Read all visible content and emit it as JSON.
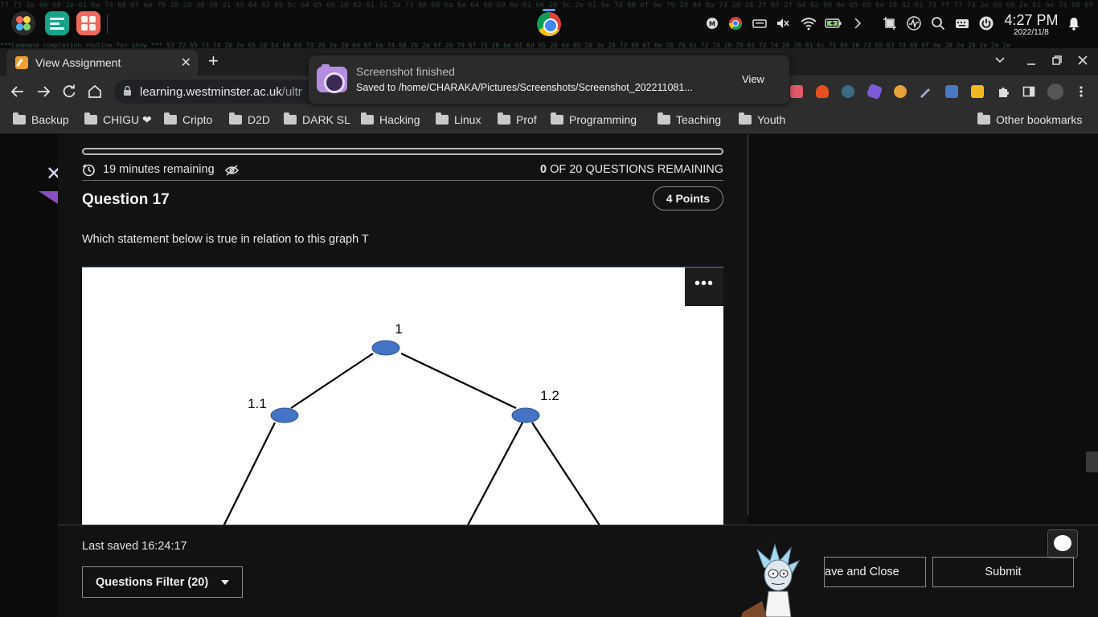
{
  "os_panel": {
    "clock_time": "4:27 PM",
    "clock_date": "2022/11/8",
    "hex_line_top": "77 73 2e 66 68 2e 61 6e 74 68 6f 6e 79 20 29 30 38 31 43 64 63 69 6c 64 65 66 20 42 61 31 3a 73 68 68 6a 6e 64 68 69 6e 61 66 20 3c 2e 61 6e 74 68 6f 6e 79 20 84 8a 73 28 28 2f 6f 2f 64 62 69 6e 65 65 64 20 42 61 73 ff 77 73 2e 66 68 2e 61 6e 74 68 6f 6e 79 69 6e 64 65 66",
    "hex_line_bottom": "***Command completion routine for show *** 53 72 65 73 74 20 2a 65 20 54 68 69 73 20 3a 20 6d 6f 6e 74 68 20 2a 6f 20 79 6f 75 20 6e 61 6d 65 20 6d 65 20 3a 20 73 69 67 6e 20 70 61 72 74 20 70 61 72 74 20 76 61 6c 75 65 20 73 65 63 74 69 6f 6e 20 2a 20 2e 2e 2e"
  },
  "browser": {
    "tab_title": "View Assignment",
    "url_host": "learning.westminster.ac.uk",
    "url_path": "/ultr",
    "bookmarks": [
      "Backup",
      "CHIGU ❤",
      "Cripto",
      "D2D",
      "DARK SL",
      "Hacking",
      "Linux",
      "Prof",
      "Programming",
      "Teaching",
      "Youth"
    ],
    "other_bookmarks": "Other bookmarks"
  },
  "notification": {
    "title": "Screenshot finished",
    "body": "Saved to /home/CHARAKA/Pictures/Screenshots/Screenshot_202211081...",
    "action": "View"
  },
  "assessment": {
    "time_remaining": "19 minutes remaining",
    "questions_remaining_count": "0",
    "questions_remaining_label": "OF 20 QUESTIONS REMAINING",
    "question_title": "Question 17",
    "points": "4 Points",
    "question_text": "Which statement below is true in relation to this graph T",
    "more_menu": "•••",
    "last_saved": "Last saved 16:24:17",
    "filter_label": "Questions Filter (20)",
    "save_close_label": "ave and Close",
    "submit_label": "Submit"
  },
  "graph": {
    "node_color": "#4472c4",
    "nodes": [
      {
        "id": "root",
        "label": "1"
      },
      {
        "id": "n11",
        "label": "1.1"
      },
      {
        "id": "n12",
        "label": "1.2"
      }
    ],
    "edges": [
      {
        "from": "root",
        "to": "n11"
      },
      {
        "from": "root",
        "to": "n12"
      }
    ]
  },
  "colors": {
    "accent_purple": "#8a4fbf",
    "close_x": "#d7d7ff"
  }
}
